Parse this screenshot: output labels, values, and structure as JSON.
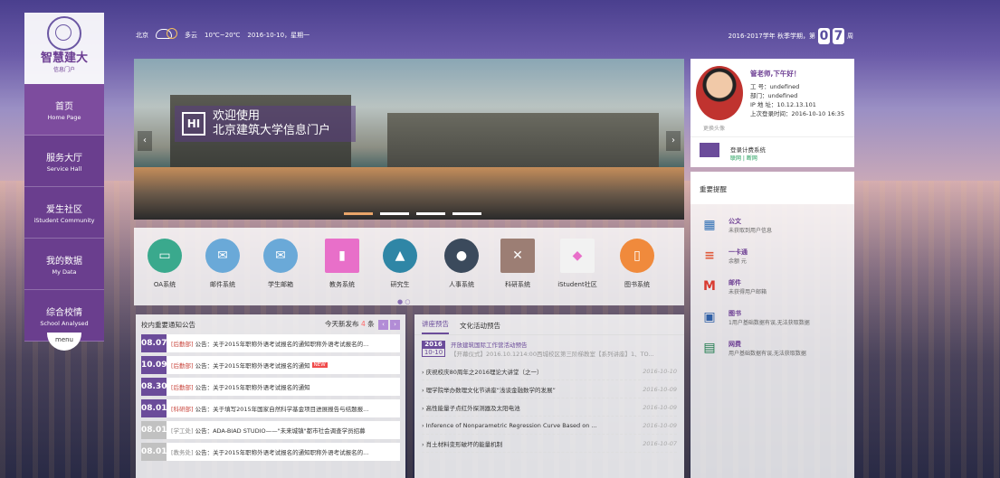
{
  "topbar": {
    "city": "北京",
    "weather": "多云",
    "temp": "10℃~20℃",
    "date": "2016-10-10，星期一",
    "term": "2016-2017学年  秋季学期，第",
    "week_digits": [
      "0",
      "7"
    ],
    "week_suffix": "周"
  },
  "logo": {
    "name": "智慧建大",
    "sub": "信息门户"
  },
  "nav": [
    {
      "cn": "首页",
      "en": "Home Page"
    },
    {
      "cn": "服务大厅",
      "en": "Service Hall"
    },
    {
      "cn": "爱生社区",
      "en": "iStudent Community"
    },
    {
      "cn": "我的数据",
      "en": "My Data"
    },
    {
      "cn": "综合校情",
      "en": "School Analysed"
    }
  ],
  "menu_label": "menu",
  "banner": {
    "badge": "HI",
    "line1": "欢迎使用",
    "line2": "北京建筑大学信息门户",
    "prev": "‹",
    "next": "›"
  },
  "apps": [
    {
      "label": "OA系统",
      "icon": "monitor-icon",
      "color": "#3aa98d",
      "glyph": "▭"
    },
    {
      "label": "邮件系统",
      "icon": "mail-icon",
      "color": "#6aa9d8",
      "glyph": "✉"
    },
    {
      "label": "学生邮箱",
      "icon": "mail-icon",
      "color": "#6aa9d8",
      "glyph": "✉"
    },
    {
      "label": "教务系统",
      "icon": "book-icon",
      "color": "#e86fc9",
      "glyph": "▮"
    },
    {
      "label": "研究生",
      "icon": "graduation-cap-icon",
      "color": "#2f86a6",
      "glyph": "▲"
    },
    {
      "label": "人事系统",
      "icon": "person-icon",
      "color": "#3b4a5c",
      "glyph": "●"
    },
    {
      "label": "科研系统",
      "icon": "tools-icon",
      "color": "#9c7e74",
      "glyph": "✕"
    },
    {
      "label": "iStudent社区",
      "icon": "istudent-icon",
      "color": "#f2f2f2",
      "glyph": "◆"
    },
    {
      "label": "图书系统",
      "icon": "library-icon",
      "color": "#f08a3c",
      "glyph": "▯"
    }
  ],
  "apps_pager": "● ○",
  "notice": {
    "title": "校内重要通知公告",
    "today_prefix": "今天新发布",
    "today_count": "4",
    "today_suffix": "条",
    "items": [
      {
        "date": "08.07",
        "tag": "[后勤部]",
        "text": "公告：关于2015年职称外语考试报名的通知职称外语考试报名的...",
        "gray": false,
        "new": ""
      },
      {
        "date": "10.09",
        "tag": "[后勤部]",
        "text": "公告：关于2015年职称外语考试报名的通知",
        "gray": false,
        "new": "NEW"
      },
      {
        "date": "08.30",
        "tag": "[后勤部]",
        "text": "公告：关于2015年职称外语考试报名的通知",
        "gray": false,
        "new": ""
      },
      {
        "date": "08.01",
        "tag": "[科研部]",
        "text": "公告：关于填写2015年国家自然科学基金项目进展报告与结题报...",
        "gray": false,
        "new": ""
      },
      {
        "date": "08.01",
        "tag": "[学工处]",
        "text": "公告：ADA-BIAD STUDIO——\"未来城镇\"都市社会调查学员招募",
        "gray": true,
        "new": ""
      },
      {
        "date": "08.01",
        "tag": "[教务处]",
        "text": "公告：关于2015年职称外语考试报名的通知职称外语考试报名的...",
        "gray": true,
        "new": ""
      }
    ]
  },
  "lectures": {
    "tab1": "讲座预告",
    "tab2": "文化活动预告",
    "featured": {
      "year": "2016",
      "day": "10-10",
      "title": "开放建筑国际工作营活动预告",
      "sub": "【开幕仪式】2016.10.1214:00西城校区第三阶梯教室【系列讲座】1、TO..."
    },
    "items": [
      {
        "text": "› 庆祝校庆80周年之2016理论大讲堂（之一）",
        "date": "2016-10-10"
      },
      {
        "text": "› 理学院举办数理文化节讲座“浅谈金融数学的发展”",
        "date": "2016-10-09"
      },
      {
        "text": "› 高性能量子点红外探测器及太阳电池",
        "date": "2016-10-09"
      },
      {
        "text": "› Inference of Nonparametric Regression Curve Based on ...",
        "date": "2016-10-09"
      },
      {
        "text": "› 肖土材料变形破坏的能量机制",
        "date": "2016-10-07"
      }
    ]
  },
  "user": {
    "greeting": "管老师,下午好！",
    "id_line": "工  号：undefined",
    "dept_line": "部门：undefined",
    "ip_line": "IP 地 址：10.12.13.101",
    "last_login": "上次登录时间：2016-10-10 16:35",
    "avatar_label": "更换头像",
    "login_title": "登录计费系统",
    "login_links": "联网 | 断网"
  },
  "reminders": {
    "title": "重要提醒",
    "items": [
      {
        "name": "公文",
        "desc": "未获取到用户信息",
        "icon": "calendar-icon",
        "glyph": "▦",
        "color": "#2f6fb4"
      },
      {
        "name": "一卡通",
        "desc": "余额   元",
        "icon": "card-list-icon",
        "glyph": "≡",
        "color": "#e05a3a"
      },
      {
        "name": "邮件",
        "desc": "未获得用户邮箱",
        "icon": "gmail-icon",
        "glyph": "M",
        "color": "#d93b30"
      },
      {
        "name": "图书",
        "desc": "1用户基础数据有误,无法获取数据",
        "icon": "book-monitor-icon",
        "glyph": "▣",
        "color": "#2f5fa6"
      },
      {
        "name": "网费",
        "desc": "用户基础数据有误,无法获取数据",
        "icon": "network-monitor-icon",
        "glyph": "▤",
        "color": "#1c7a4a"
      }
    ]
  }
}
